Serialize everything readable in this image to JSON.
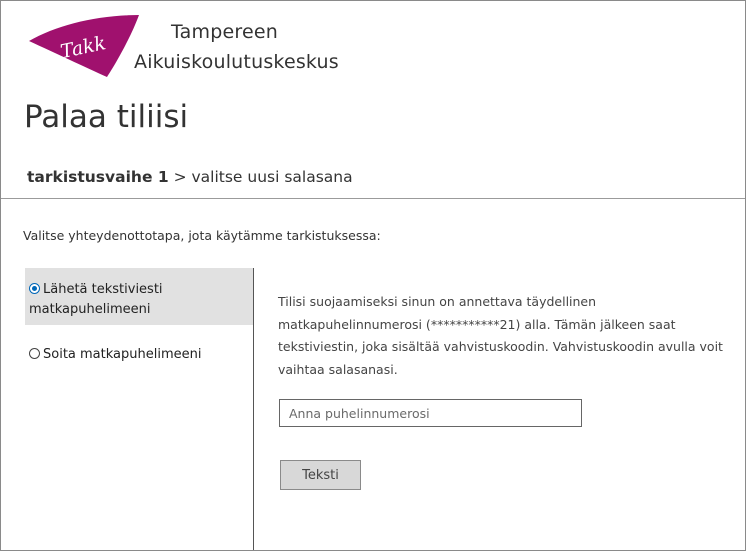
{
  "header": {
    "logo_text": "Takk",
    "org_line1": "Tampereen",
    "org_line2": "Aikuiskoulutuskeskus"
  },
  "page_title": "Palaa tiliisi",
  "steps": {
    "current": "tarkistusvaihe 1",
    "separator": " > ",
    "next": "valitse uusi salasana"
  },
  "instruction": "Valitse yhteydenottotapa, jota käytämme tarkistuksessa:",
  "methods": [
    {
      "label_line1": "Lähetä tekstiviesti",
      "label_line2": "matkapuhelimeeni",
      "selected": true
    },
    {
      "label_line1": "Soita matkapuhelimeeni",
      "label_line2": "",
      "selected": false
    }
  ],
  "info_text": "Tilisi suojaamiseksi sinun on annettava täydellinen matkapuhelinnumerosi (***********21) alla. Tämän jälkeen saat tekstiviestin, joka sisältää vahvistuskoodin. Vahvistuskoodin avulla voit vaihtaa salasanasi.",
  "phone_input": {
    "value": "",
    "placeholder": "Anna puhelinnumerosi"
  },
  "send_button_label": "Teksti",
  "colors": {
    "logo": "#a0116e",
    "radio_accent": "#0067b8",
    "selected_bg": "#e1e1e1"
  }
}
